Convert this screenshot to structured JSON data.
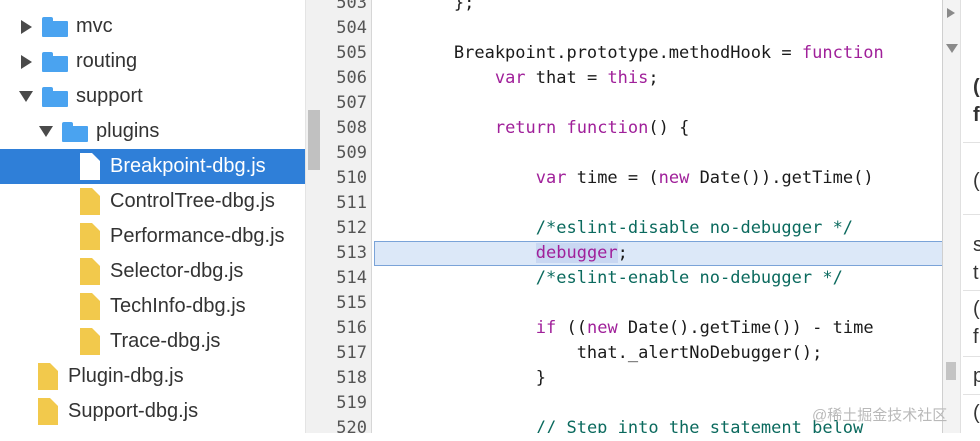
{
  "file_tree": {
    "items": [
      {
        "label": "mvc",
        "type": "folder",
        "expanded": false,
        "level": 0
      },
      {
        "label": "routing",
        "type": "folder",
        "expanded": false,
        "level": 0
      },
      {
        "label": "support",
        "type": "folder",
        "expanded": true,
        "level": 0
      },
      {
        "label": "plugins",
        "type": "folder",
        "expanded": true,
        "level": 1
      },
      {
        "label": "Breakpoint-dbg.js",
        "type": "file",
        "selected": true,
        "level": 2
      },
      {
        "label": "ControlTree-dbg.js",
        "type": "file",
        "level": 2
      },
      {
        "label": "Performance-dbg.js",
        "type": "file",
        "level": 2
      },
      {
        "label": "Selector-dbg.js",
        "type": "file",
        "level": 2
      },
      {
        "label": "TechInfo-dbg.js",
        "type": "file",
        "level": 2
      },
      {
        "label": "Trace-dbg.js",
        "type": "file",
        "level": 2
      },
      {
        "label": "Plugin-dbg.js",
        "type": "file",
        "level": 1
      },
      {
        "label": "Support-dbg.js",
        "type": "file",
        "level": 1
      }
    ]
  },
  "editor": {
    "highlighted_line": "513",
    "lines": [
      {
        "num": "503",
        "segments": [
          {
            "t": "        };",
            "c": ""
          }
        ]
      },
      {
        "num": "504",
        "segments": []
      },
      {
        "num": "505",
        "segments": [
          {
            "t": "        Breakpoint.prototype.methodHook = ",
            "c": ""
          },
          {
            "t": "function",
            "c": "kw"
          }
        ]
      },
      {
        "num": "506",
        "segments": [
          {
            "t": "            ",
            "c": ""
          },
          {
            "t": "var",
            "c": "kw"
          },
          {
            "t": " that = ",
            "c": ""
          },
          {
            "t": "this",
            "c": "kw"
          },
          {
            "t": ";",
            "c": ""
          }
        ]
      },
      {
        "num": "507",
        "segments": []
      },
      {
        "num": "508",
        "segments": [
          {
            "t": "            ",
            "c": ""
          },
          {
            "t": "return",
            "c": "kw"
          },
          {
            "t": " ",
            "c": ""
          },
          {
            "t": "function",
            "c": "kw"
          },
          {
            "t": "() {",
            "c": ""
          }
        ]
      },
      {
        "num": "509",
        "segments": []
      },
      {
        "num": "510",
        "segments": [
          {
            "t": "                ",
            "c": ""
          },
          {
            "t": "var",
            "c": "kw"
          },
          {
            "t": " time = (",
            "c": ""
          },
          {
            "t": "new",
            "c": "kw"
          },
          {
            "t": " Date()).getTime()",
            "c": ""
          }
        ]
      },
      {
        "num": "511",
        "segments": []
      },
      {
        "num": "512",
        "segments": [
          {
            "t": "                ",
            "c": ""
          },
          {
            "t": "/*eslint-disable no-debugger */",
            "c": "cm"
          }
        ]
      },
      {
        "num": "513",
        "segments": [
          {
            "t": "                ",
            "c": ""
          },
          {
            "t": "debugger",
            "c": "dbg"
          },
          {
            "t": ";",
            "c": ""
          }
        ]
      },
      {
        "num": "514",
        "segments": [
          {
            "t": "                ",
            "c": ""
          },
          {
            "t": "/*eslint-enable no-debugger */",
            "c": "cm"
          }
        ]
      },
      {
        "num": "515",
        "segments": []
      },
      {
        "num": "516",
        "segments": [
          {
            "t": "                ",
            "c": ""
          },
          {
            "t": "if",
            "c": "kw"
          },
          {
            "t": " ((",
            "c": ""
          },
          {
            "t": "new",
            "c": "kw"
          },
          {
            "t": " Date().getTime()) - time",
            "c": ""
          }
        ]
      },
      {
        "num": "517",
        "segments": [
          {
            "t": "                    that._alertNoDebugger();",
            "c": ""
          }
        ]
      },
      {
        "num": "518",
        "segments": [
          {
            "t": "                }",
            "c": ""
          }
        ]
      },
      {
        "num": "519",
        "segments": []
      },
      {
        "num": "520",
        "segments": [
          {
            "t": "                ",
            "c": ""
          },
          {
            "t": "// Step into the statement below",
            "c": "cm"
          }
        ]
      }
    ]
  },
  "right_panel": {
    "fragments": [
      "(",
      "f",
      "(",
      "s",
      "t",
      "(",
      "f",
      "p",
      "("
    ]
  },
  "watermark": "@稀土掘金技术社区",
  "colors": {
    "selection": "#2f7fd8",
    "folder": "#4aa3f0",
    "file": "#f2c94c",
    "keyword": "#a0209a",
    "comment": "#0b6a5e",
    "line_highlight": "#dce8f8"
  }
}
